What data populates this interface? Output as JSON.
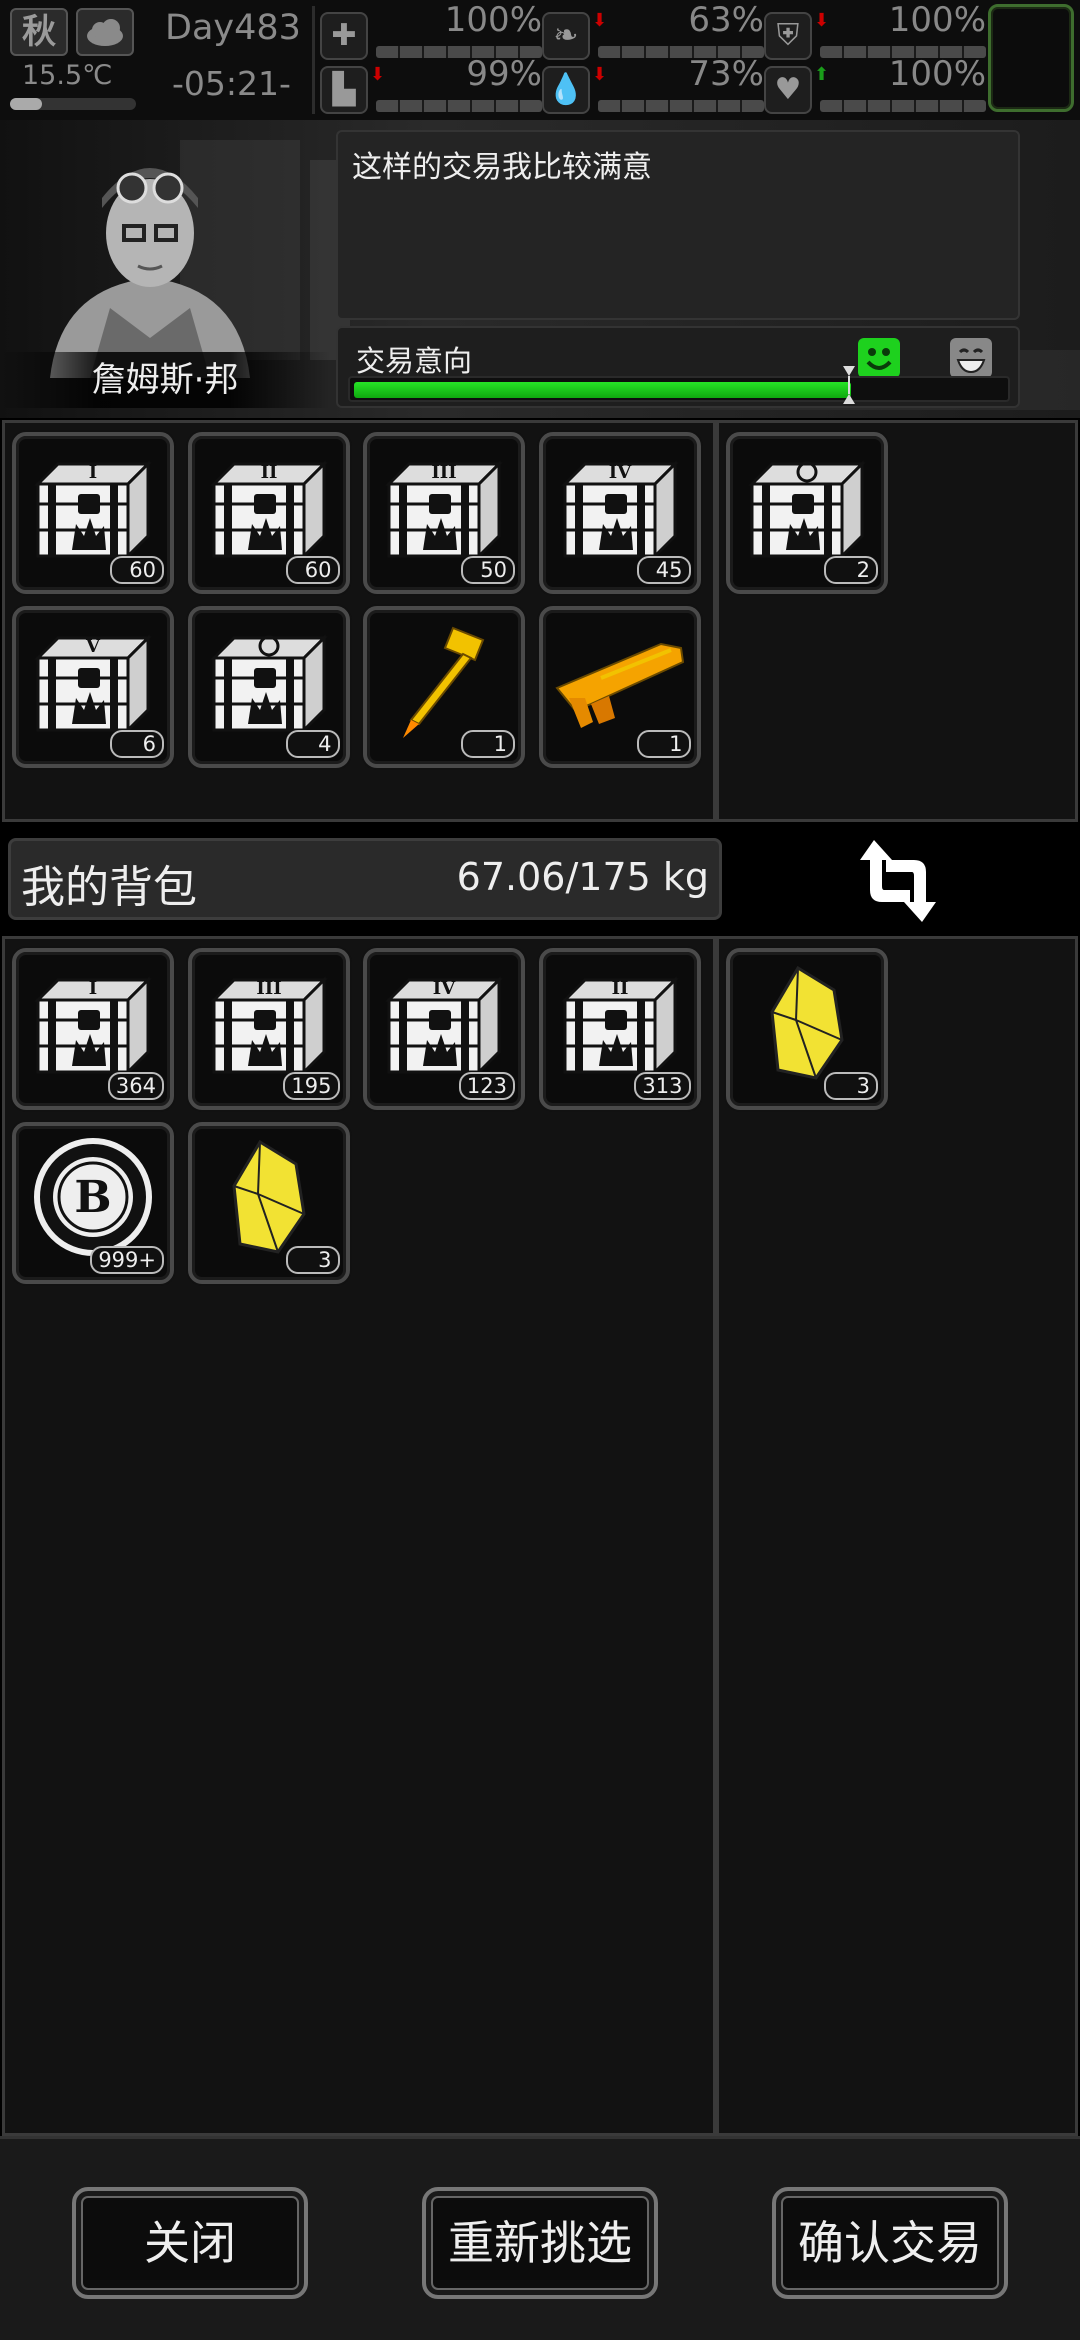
{
  "status": {
    "season": "秋",
    "temperature": "15.5℃",
    "temperature_level": 0.25,
    "day": "Day483",
    "time": "-05:21-",
    "stats": [
      {
        "icon": "medkit-icon",
        "value": "100%",
        "arrow": ""
      },
      {
        "icon": "stomach-icon",
        "value": "63%",
        "arrow": "down"
      },
      {
        "icon": "lock-icon",
        "value": "100%",
        "arrow": "down"
      },
      {
        "icon": "boot-icon",
        "value": "99%",
        "arrow": "down"
      },
      {
        "icon": "water-drop-icon",
        "value": "73%",
        "arrow": "down"
      },
      {
        "icon": "heart-icon",
        "value": "100%",
        "arrow": "up"
      }
    ]
  },
  "trader": {
    "name": "詹姆斯·邦",
    "message": "这样的交易我比较满意",
    "intent_label": "交易意向",
    "intent_level": 0.76
  },
  "trader_items": [
    {
      "type": "crate",
      "numeral": "I",
      "count": "60"
    },
    {
      "type": "crate",
      "numeral": "II",
      "count": "60"
    },
    {
      "type": "crate",
      "numeral": "III",
      "count": "50"
    },
    {
      "type": "crate",
      "numeral": "IV",
      "count": "45"
    },
    {
      "type": "crate",
      "numeral": "V",
      "count": "6"
    },
    {
      "type": "crate-special",
      "numeral": "",
      "count": "4"
    },
    {
      "type": "hammer",
      "numeral": "",
      "count": "1"
    },
    {
      "type": "gun",
      "numeral": "",
      "count": "1"
    }
  ],
  "trader_offer": [
    {
      "type": "crate-special",
      "numeral": "",
      "count": "2"
    }
  ],
  "backpack": {
    "title": "我的背包",
    "weight": "67.06/175 kg"
  },
  "my_items": [
    {
      "type": "crate",
      "numeral": "I",
      "count": "364"
    },
    {
      "type": "crate",
      "numeral": "III",
      "count": "195"
    },
    {
      "type": "crate",
      "numeral": "IV",
      "count": "123"
    },
    {
      "type": "crate",
      "numeral": "II",
      "count": "313"
    },
    {
      "type": "coin",
      "numeral": "B",
      "count": "999+"
    },
    {
      "type": "crystal",
      "numeral": "",
      "count": "3"
    }
  ],
  "my_offer": [
    {
      "type": "crystal",
      "numeral": "",
      "count": "3"
    }
  ],
  "buttons": {
    "close": "关闭",
    "reselect": "重新挑选",
    "confirm": "确认交易"
  },
  "colors": {
    "intent_green": "#1ed11e",
    "gold": "#f2c200"
  }
}
